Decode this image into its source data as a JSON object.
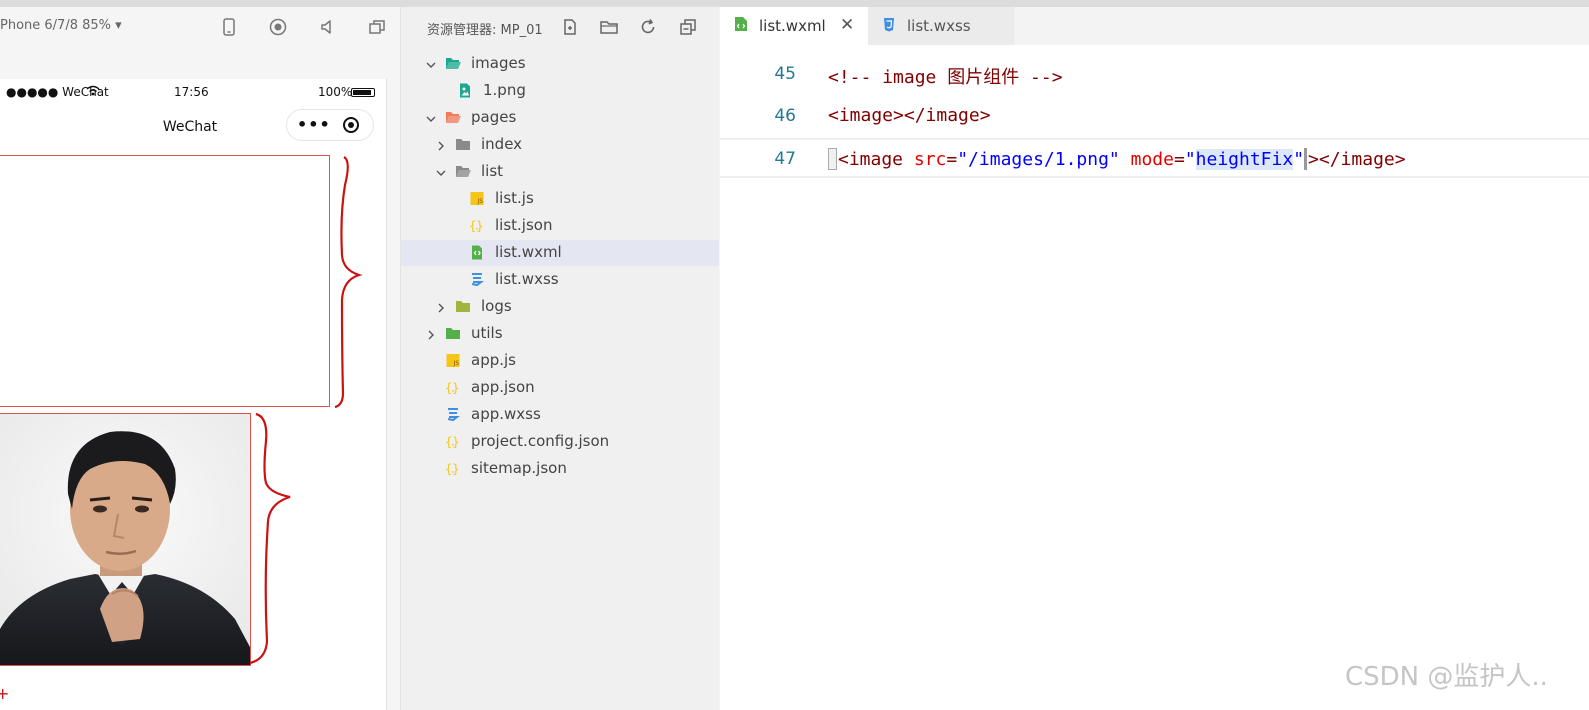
{
  "simulator": {
    "device_label": "Phone 6/7/8 85% ▾",
    "toolbar_icons": [
      "phone-icon",
      "record-icon",
      "volume-icon",
      "window-icon"
    ],
    "status_bar": {
      "signal": "●●●●● WeChat",
      "time": "17:56",
      "battery": "100%"
    },
    "nav_title": "WeChat",
    "capsule_more": "•••"
  },
  "explorer": {
    "title": "资源管理器: MP_01",
    "toolbar_icons": [
      "new-file-icon",
      "new-folder-icon",
      "refresh-icon",
      "collapse-icon"
    ],
    "tree": [
      {
        "label": "images",
        "type": "folder-open",
        "color": "#1aa88e"
      },
      {
        "label": "1.png",
        "type": "image",
        "color": "#1aa88e"
      },
      {
        "label": "pages",
        "type": "folder-open",
        "color": "#f07c5b"
      },
      {
        "label": "index",
        "type": "folder",
        "color": "#8a8a8a"
      },
      {
        "label": "list",
        "type": "folder-open",
        "color": "#8a8a8a"
      },
      {
        "label": "list.js",
        "type": "js",
        "color": "#f5c518"
      },
      {
        "label": "list.json",
        "type": "json",
        "color": "#f5c518"
      },
      {
        "label": "list.wxml",
        "type": "wxml",
        "color": "#55b04b"
      },
      {
        "label": "list.wxss",
        "type": "wxss",
        "color": "#3d8fe0"
      },
      {
        "label": "logs",
        "type": "folder",
        "color": "#a0b53c"
      },
      {
        "label": "utils",
        "type": "folder",
        "color": "#55b04b"
      },
      {
        "label": "app.js",
        "type": "js",
        "color": "#f5c518"
      },
      {
        "label": "app.json",
        "type": "json",
        "color": "#f5c518"
      },
      {
        "label": "app.wxss",
        "type": "wxss",
        "color": "#3d8fe0"
      },
      {
        "label": "project.config.json",
        "type": "json",
        "color": "#f5c518"
      },
      {
        "label": "sitemap.json",
        "type": "json",
        "color": "#f5c518"
      }
    ],
    "selected": "list.wxml"
  },
  "editor": {
    "tabs": [
      {
        "label": "list.wxml",
        "active": true,
        "close": "✕"
      },
      {
        "label": "list.wxss",
        "active": false
      }
    ],
    "lines": [
      {
        "number": "45",
        "comment": "<!-- image 图片组件 -->"
      },
      {
        "number": "46",
        "text": "<image></image>"
      },
      {
        "number": "47",
        "open": "<image ",
        "attr1": "src",
        "eq1": "=",
        "val1": "\"/images/1.png\"",
        "attr2": " mode",
        "eq2": "=",
        "q_open": "\"",
        "val2": "heightFix",
        "q_close": "\"",
        "close": "></image>"
      }
    ]
  },
  "watermark": "CSDN @监护人..",
  "colors": {
    "accent_selected": "#e4e6f1",
    "border_red": "#d9534f",
    "comment_green": "#008000",
    "tag_maroon": "#800000",
    "attr_red": "#e50000",
    "string_blue": "#0000ff",
    "line_number": "#237893"
  }
}
